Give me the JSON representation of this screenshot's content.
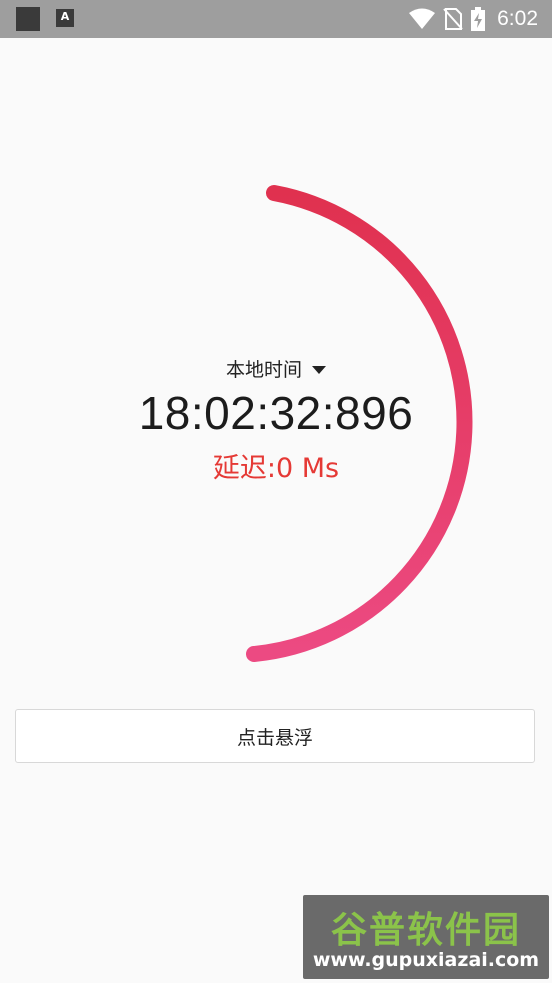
{
  "status_bar": {
    "time": "6:02",
    "notification_icon_letter": "A",
    "icons": [
      "app-square-icon",
      "a-notification-icon",
      "wifi-icon",
      "no-sim-icon",
      "battery-charging-icon"
    ]
  },
  "clock": {
    "mode_label": "本地时间",
    "time": "18:02:32:896",
    "delay": "延迟:0 Ms",
    "progress_fraction": 0.5,
    "ring_colors": {
      "start": "#e0314f",
      "end": "#ec4a82"
    }
  },
  "actions": {
    "float_button_label": "点击悬浮"
  },
  "watermark": {
    "title": "谷普软件园",
    "url": "www.gupuxiazai.com"
  },
  "colors": {
    "background": "#fafafa",
    "status_bar": "#9e9e9e",
    "delay_text": "#e53935"
  }
}
